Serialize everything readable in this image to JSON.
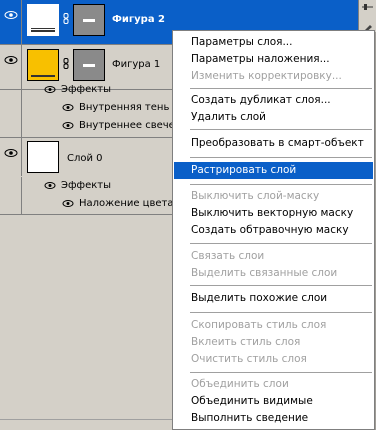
{
  "layers": [
    {
      "name": "Фигура 2",
      "selected": true,
      "thumb": "white",
      "bold": true
    },
    {
      "name": "Фигура 1",
      "selected": false,
      "thumb": "yellow",
      "bold": false
    },
    {
      "name": "Слой 0",
      "selected": false,
      "thumb": "white",
      "bold": false
    }
  ],
  "effects_label": "Эффекты",
  "effects": {
    "figure1": [
      "Внутренняя тень",
      "Внутреннее свечение"
    ],
    "layer0": [
      "Наложение цвета"
    ]
  },
  "menu": {
    "items": [
      {
        "label": "Параметры слоя...",
        "disabled": false
      },
      {
        "label": "Параметры наложения...",
        "disabled": false
      },
      {
        "label": "Изменить корректировку...",
        "disabled": true
      },
      {
        "label": "Создать дубликат слоя...",
        "disabled": false
      },
      {
        "label": "Удалить слой",
        "disabled": false
      },
      {
        "label": "Преобразовать в смарт-объект",
        "disabled": false
      },
      {
        "label": "Растрировать слой",
        "disabled": false,
        "highlighted": true
      },
      {
        "label": "Выключить слой-маску",
        "disabled": true
      },
      {
        "label": "Выключить векторную маску",
        "disabled": false
      },
      {
        "label": "Создать обтравочную маску",
        "disabled": false
      },
      {
        "label": "Связать слои",
        "disabled": true
      },
      {
        "label": "Выделить связанные слои",
        "disabled": true
      },
      {
        "label": "Выделить похожие слои",
        "disabled": false
      },
      {
        "label": "Скопировать стиль слоя",
        "disabled": true
      },
      {
        "label": "Вклеить стиль слоя",
        "disabled": true
      },
      {
        "label": "Очистить стиль слоя",
        "disabled": true
      },
      {
        "label": "Объединить слои",
        "disabled": true
      },
      {
        "label": "Объединить видимые",
        "disabled": false
      },
      {
        "label": "Выполнить сведение",
        "disabled": false
      }
    ]
  },
  "colors": {
    "selection": "#0a5fc8",
    "panel_bg": "#d4d0c8",
    "disabled_text": "#a0a0a0",
    "yellow_thumb": "#f8c000"
  }
}
